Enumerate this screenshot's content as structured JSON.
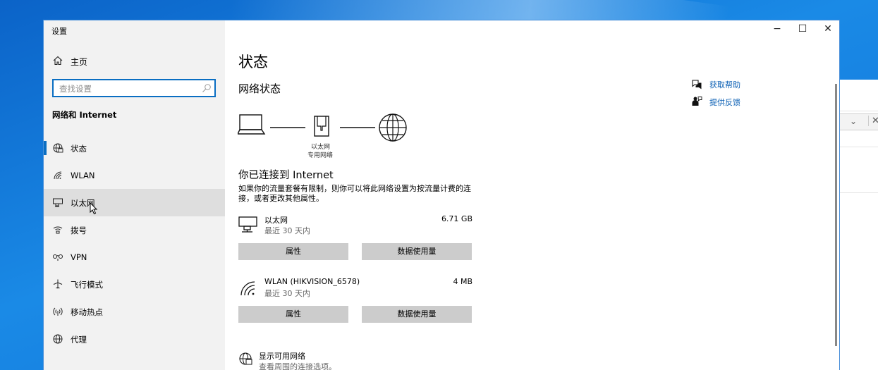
{
  "window": {
    "title": "设置",
    "controls": {
      "minimize": "−",
      "maximize": "☐",
      "close": "✕"
    }
  },
  "sidebar": {
    "home_label": "主页",
    "search_placeholder": "查找设置",
    "section_title": "网络和 Internet",
    "items": [
      {
        "label": "状态",
        "icon": "status-globe-icon",
        "selected": true
      },
      {
        "label": "WLAN",
        "icon": "wifi-icon"
      },
      {
        "label": "以太网",
        "icon": "ethernet-icon",
        "hover": true
      },
      {
        "label": "拨号",
        "icon": "dialup-icon"
      },
      {
        "label": "VPN",
        "icon": "vpn-icon"
      },
      {
        "label": "飞行模式",
        "icon": "airplane-icon"
      },
      {
        "label": "移动热点",
        "icon": "hotspot-icon"
      },
      {
        "label": "代理",
        "icon": "proxy-globe-icon"
      }
    ]
  },
  "main": {
    "page_title": "状态",
    "network_status_heading": "网络状态",
    "diagram": {
      "label_line1": "以太网",
      "label_line2": "专用网络"
    },
    "connected_heading": "你已连接到 Internet",
    "connected_description": "如果你的流量套餐有限制，则你可以将此网络设置为按流量计费的连接，或者更改其他属性。",
    "adapters": [
      {
        "name": "以太网",
        "sub": "最近 30 天内",
        "usage": "6.71 GB",
        "icon": "ethernet-adapter-icon",
        "properties_label": "属性",
        "data_usage_label": "数据使用量"
      },
      {
        "name": "WLAN (HIKVISION_6578)",
        "sub": "最近 30 天内",
        "usage": "4 MB",
        "icon": "wifi-adapter-icon",
        "properties_label": "属性",
        "data_usage_label": "数据使用量"
      }
    ],
    "show_networks": {
      "title": "显示可用网络",
      "subtitle": "查看周围的连接选项。"
    }
  },
  "help": {
    "get_help": "获取帮助",
    "give_feedback": "提供反馈"
  },
  "colors": {
    "accent": "#0a6ec2",
    "link": "#0a5fb4",
    "sidebar_bg": "#f2f2f2",
    "button_bg": "#cccccc"
  }
}
